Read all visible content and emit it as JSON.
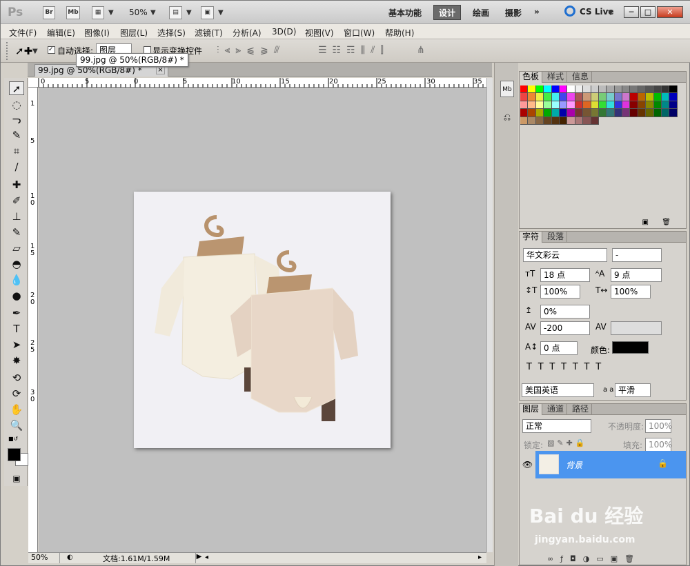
{
  "app": {
    "logo": "Ps",
    "bridge": "Br",
    "minibridge": "Mb",
    "zoom": "50%"
  },
  "workspaces": [
    "基本功能",
    "设计",
    "绘画",
    "摄影"
  ],
  "workspace_active": "设计",
  "cslive": "CS Live",
  "window_buttons": [
    "─",
    "□",
    "✕"
  ],
  "menus": [
    "文件(F)",
    "编辑(E)",
    "图像(I)",
    "图层(L)",
    "选择(S)",
    "滤镜(T)",
    "分析(A)",
    "3D(D)",
    "视图(V)",
    "窗口(W)",
    "帮助(H)"
  ],
  "options": {
    "auto_select": "自动选择:",
    "auto_select_value": "图层",
    "show_transform": "显示变换控件"
  },
  "tooltip": "99.jpg @ 50%(RGB/8#) *",
  "doc_tab": {
    "title": "99.jpg @ 50%(RGB/8#) *",
    "close": "×"
  },
  "ruler": {
    "h": [
      "0",
      "5",
      "0",
      "5",
      "10",
      "15",
      "20",
      "25",
      "30",
      "35"
    ],
    "v": [
      "1",
      "5",
      "1",
      "0",
      "1",
      "5",
      "2",
      "0",
      "2",
      "5",
      "3",
      "0"
    ]
  },
  "status": {
    "zoom": "50%",
    "doc": "文档:1.61M/1.59M"
  },
  "swatch_panel": {
    "tabs": [
      "色板",
      "样式",
      "信息"
    ]
  },
  "char_panel": {
    "tabs": [
      "字符",
      "段落"
    ],
    "font": "华文彩云",
    "style": "-",
    "size": "18 点",
    "leading": "9 点",
    "vscale": "100%",
    "hscale": "100%",
    "baseline_shift": "0%",
    "tracking": "-200",
    "kerning": "",
    "tsume": "0 点",
    "color_label": "颜色:",
    "language": "美国英语",
    "aa_label": "a a",
    "antialias": "平滑"
  },
  "layers_panel": {
    "tabs": [
      "图层",
      "通道",
      "路径"
    ],
    "mode": "正常",
    "opacity_label": "不透明度:",
    "opacity": "100%",
    "lock_label": "锁定:",
    "fill_label": "填充:",
    "fill": "100%",
    "layer_name": "背景"
  },
  "watermark": {
    "brand": "Bai du 经验",
    "url": "jingyan.baidu.com"
  },
  "colors": {
    "accent": "#4b95ef",
    "active_workspace": "#6b6b6b"
  }
}
